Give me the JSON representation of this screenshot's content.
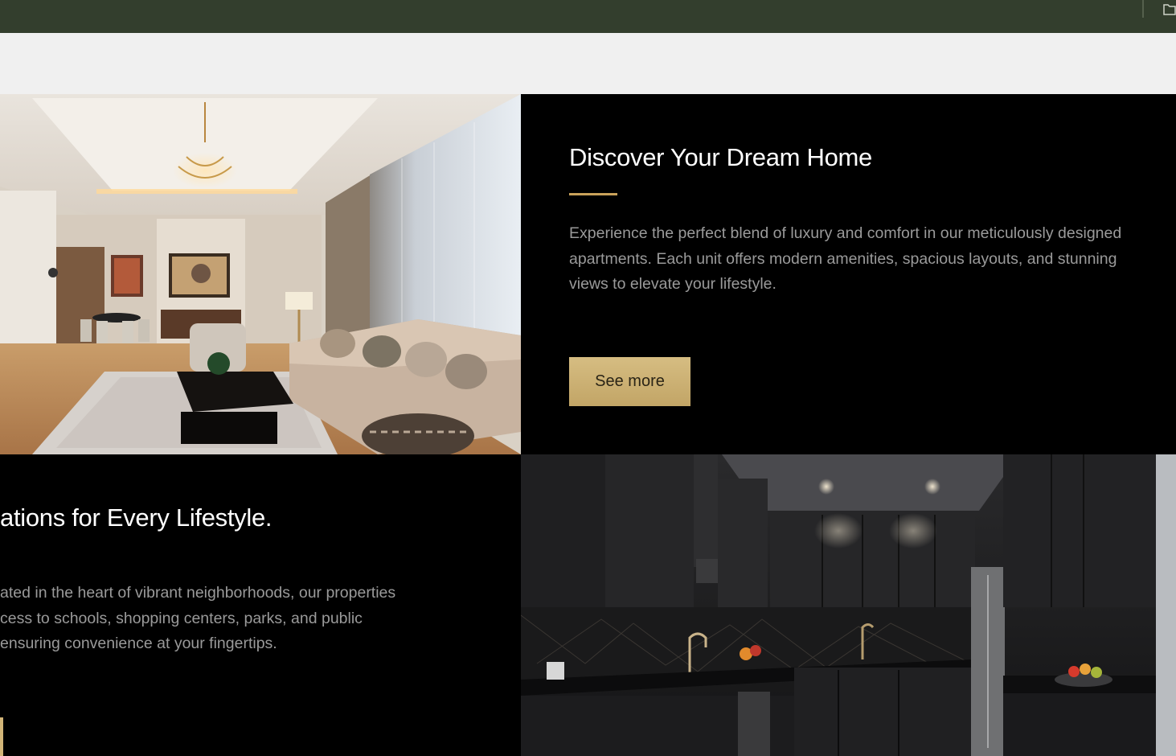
{
  "sections": [
    {
      "heading": "Discover Your Dream Home",
      "body": "Experience the perfect blend of luxury and comfort in our meticulously designed apartments. Each unit offers modern amenities, spacious layouts, and stunning views to elevate your lifestyle.",
      "button_label": "See more",
      "image": "luxury-living-room-photo"
    },
    {
      "heading": "ations for Every Lifestyle.",
      "body_lines": [
        "ated in the heart of vibrant neighborhoods, our properties",
        "cess to schools, shopping centers, parks, and public",
        "ensuring convenience at your fingertips."
      ],
      "image": "dark-kitchen-photo"
    }
  ],
  "colors": {
    "topbar": "#333e2d",
    "accent_gold": "#c9a25a",
    "button_gold": "#d6bd82",
    "background": "#000000",
    "body_text": "#9a9a9a"
  },
  "icons": [
    "folder-icon"
  ]
}
